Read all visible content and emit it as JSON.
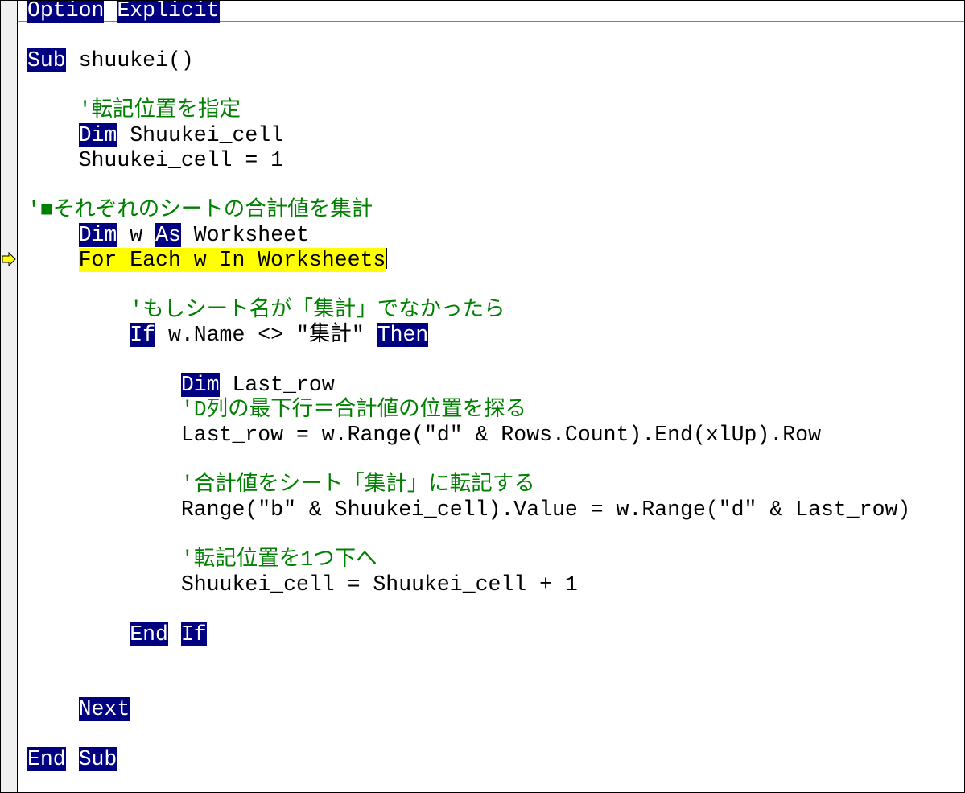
{
  "editor": {
    "colors": {
      "keyword_bg": "#000080",
      "keyword_fg": "#ffffff",
      "comment": "#008000",
      "execution_highlight": "#ffff00"
    },
    "execution_line_index": 10,
    "lines": [
      {
        "indent": 0,
        "tokens": [
          {
            "t": "kw",
            "v": "Option"
          },
          {
            "t": "tx",
            "v": " "
          },
          {
            "t": "kw",
            "v": "Explicit"
          }
        ]
      },
      {
        "indent": 0,
        "tokens": []
      },
      {
        "indent": 0,
        "tokens": [
          {
            "t": "kw",
            "v": "Sub"
          },
          {
            "t": "tx",
            "v": " shuukei()"
          }
        ]
      },
      {
        "indent": 0,
        "tokens": []
      },
      {
        "indent": 1,
        "tokens": [
          {
            "t": "cm",
            "v": "'転記位置を指定"
          }
        ]
      },
      {
        "indent": 1,
        "tokens": [
          {
            "t": "kw",
            "v": "Dim"
          },
          {
            "t": "tx",
            "v": " Shuukei_cell"
          }
        ]
      },
      {
        "indent": 1,
        "tokens": [
          {
            "t": "tx",
            "v": "Shuukei_cell = 1"
          }
        ]
      },
      {
        "indent": 0,
        "tokens": []
      },
      {
        "indent": 0,
        "tokens": [
          {
            "t": "cm",
            "v": "'■それぞれのシートの合計値を集計"
          }
        ]
      },
      {
        "indent": 1,
        "tokens": [
          {
            "t": "kw",
            "v": "Dim"
          },
          {
            "t": "tx",
            "v": " w "
          },
          {
            "t": "kw",
            "v": "As"
          },
          {
            "t": "tx",
            "v": " Worksheet"
          }
        ]
      },
      {
        "indent": 1,
        "exec": true,
        "tokens": [
          {
            "t": "tx",
            "v": "For Each w In Worksheets"
          }
        ]
      },
      {
        "indent": 0,
        "tokens": []
      },
      {
        "indent": 2,
        "tokens": [
          {
            "t": "cm",
            "v": "'もしシート名が「集計」でなかったら"
          }
        ]
      },
      {
        "indent": 2,
        "tokens": [
          {
            "t": "kw",
            "v": "If"
          },
          {
            "t": "tx",
            "v": " w.Name <> \"集計\" "
          },
          {
            "t": "kw",
            "v": "Then"
          }
        ]
      },
      {
        "indent": 0,
        "tokens": []
      },
      {
        "indent": 3,
        "tokens": [
          {
            "t": "kw",
            "v": "Dim"
          },
          {
            "t": "tx",
            "v": " Last_row"
          }
        ]
      },
      {
        "indent": 3,
        "tokens": [
          {
            "t": "cm",
            "v": "'D列の最下行＝合計値の位置を探る"
          }
        ]
      },
      {
        "indent": 3,
        "tokens": [
          {
            "t": "tx",
            "v": "Last_row = w.Range(\"d\" & Rows.Count).End(xlUp).Row"
          }
        ]
      },
      {
        "indent": 0,
        "tokens": []
      },
      {
        "indent": 3,
        "tokens": [
          {
            "t": "cm",
            "v": "'合計値をシート「集計」に転記する"
          }
        ]
      },
      {
        "indent": 3,
        "tokens": [
          {
            "t": "tx",
            "v": "Range(\"b\" & Shuukei_cell).Value = w.Range(\"d\" & Last_row)"
          }
        ]
      },
      {
        "indent": 0,
        "tokens": []
      },
      {
        "indent": 3,
        "tokens": [
          {
            "t": "cm",
            "v": "'転記位置を1つ下へ"
          }
        ]
      },
      {
        "indent": 3,
        "tokens": [
          {
            "t": "tx",
            "v": "Shuukei_cell = Shuukei_cell + 1"
          }
        ]
      },
      {
        "indent": 0,
        "tokens": []
      },
      {
        "indent": 2,
        "tokens": [
          {
            "t": "kw",
            "v": "End"
          },
          {
            "t": "tx",
            "v": " "
          },
          {
            "t": "kw",
            "v": "If"
          }
        ]
      },
      {
        "indent": 0,
        "tokens": []
      },
      {
        "indent": 0,
        "tokens": []
      },
      {
        "indent": 1,
        "tokens": [
          {
            "t": "kw",
            "v": "Next"
          }
        ]
      },
      {
        "indent": 0,
        "tokens": []
      },
      {
        "indent": 0,
        "tokens": [
          {
            "t": "kw",
            "v": "End"
          },
          {
            "t": "tx",
            "v": " "
          },
          {
            "t": "kw",
            "v": "Sub"
          }
        ]
      }
    ]
  },
  "gutter": {
    "execution_marker_icon": "execution-arrow-icon"
  }
}
